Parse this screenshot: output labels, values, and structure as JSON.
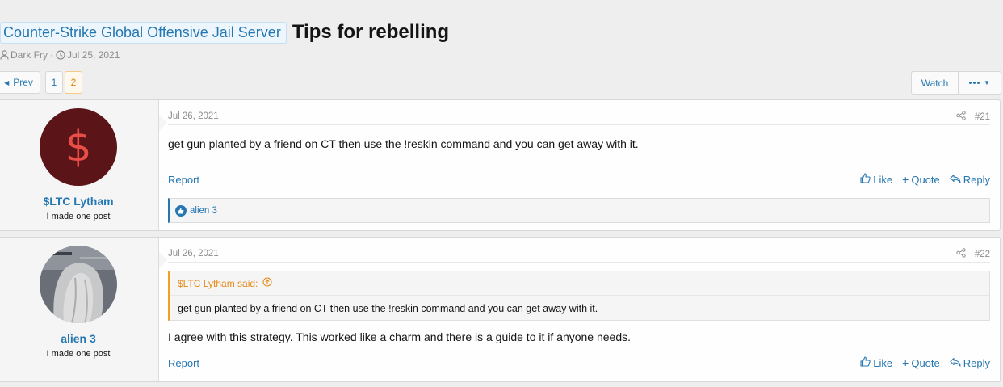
{
  "thread": {
    "prefix": "Counter-Strike Global Offensive Jail Server",
    "title": "Tips for rebelling",
    "author": "Dark Fry",
    "separator": "·",
    "date": "Jul 25, 2021"
  },
  "pagination": {
    "prev_label": "Prev",
    "pages": [
      "1",
      "2"
    ],
    "current": "2"
  },
  "thread_actions": {
    "watch_label": "Watch"
  },
  "posts": [
    {
      "username": "$LTC Lytham",
      "user_title": "I made one post",
      "avatar_glyph": "$",
      "date": "Jul 26, 2021",
      "number": "#21",
      "body": "get gun planted by a friend on CT then use the !reskin command and you can get away with it.",
      "report_label": "Report",
      "like_label": "Like",
      "quote_label": "Quote",
      "reply_label": "Reply",
      "reactions": "alien 3"
    },
    {
      "username": "alien 3",
      "user_title": "I made one post",
      "date": "Jul 26, 2021",
      "number": "#22",
      "quote_author": "$LTC Lytham said:",
      "quote_text": "get gun planted by a friend on CT then use the !reskin command and you can get away with it.",
      "body": "I agree with this strategy. This worked like a charm and there is a guide to it if anyone needs.",
      "report_label": "Report",
      "like_label": "Like",
      "quote_label": "Quote",
      "reply_label": "Reply"
    }
  ],
  "colors": {
    "link": "#2577b1",
    "quote_accent": "#f0a023",
    "current_page": "#e0810f",
    "avatar_bg": "#5b1417",
    "avatar_glyph": "#e84e45"
  }
}
